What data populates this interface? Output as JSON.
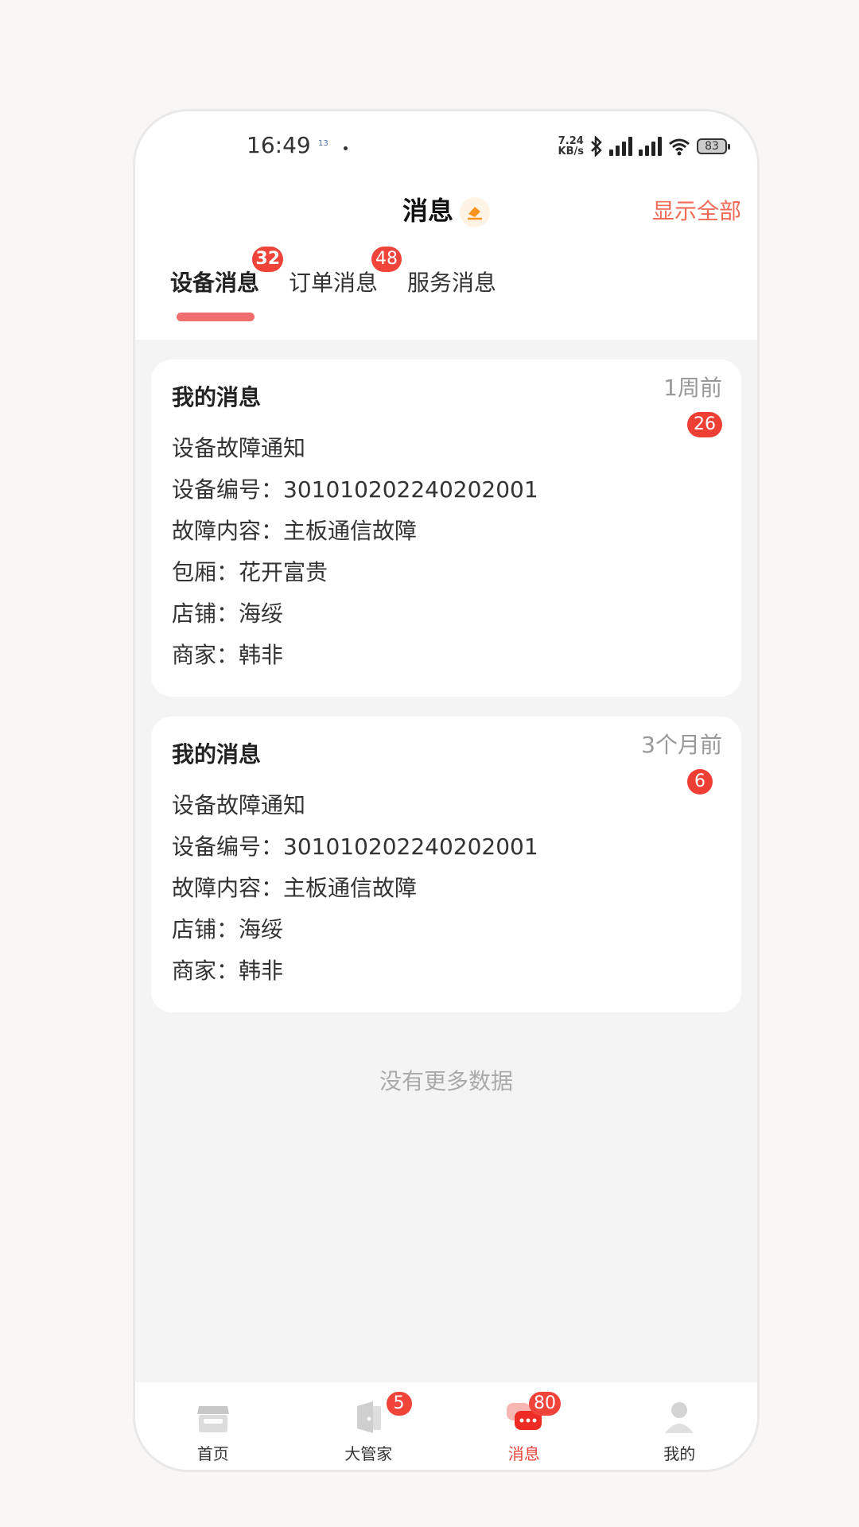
{
  "status_bar": {
    "time": "16:49",
    "small_indicator": "13",
    "net_speed_value": "7.24",
    "net_speed_unit": "KB/s",
    "battery": "83"
  },
  "header": {
    "title": "消息",
    "show_all": "显示全部"
  },
  "tabs": [
    {
      "label": "设备消息",
      "badge": "32"
    },
    {
      "label": "订单消息",
      "badge": "48"
    },
    {
      "label": "服务消息",
      "badge": ""
    }
  ],
  "cards": [
    {
      "title": "我的消息",
      "time": "1周前",
      "count": "26",
      "lines": [
        "设备故障通知",
        "设备编号：301010202240202001",
        "故障内容：主板通信故障",
        "包厢：花开富贵",
        "店铺：海绥",
        "商家：韩非"
      ]
    },
    {
      "title": "我的消息",
      "time": "3个月前",
      "count": "6",
      "lines": [
        "设备故障通知",
        "设备编号：301010202240202001",
        "故障内容：主板通信故障",
        "店铺：海绥",
        "商家：韩非"
      ]
    }
  ],
  "no_more": "没有更多数据",
  "nav": [
    {
      "label": "首页",
      "badge": "",
      "icon": "store-icon"
    },
    {
      "label": "大管家",
      "badge": "5",
      "icon": "butler-icon"
    },
    {
      "label": "消息",
      "badge": "80",
      "icon": "chat-icon"
    },
    {
      "label": "我的",
      "badge": "",
      "icon": "user-icon"
    }
  ],
  "colors": {
    "accent": "#f06b58",
    "badge": "#f0443a",
    "active_nav": "#e9453a"
  }
}
